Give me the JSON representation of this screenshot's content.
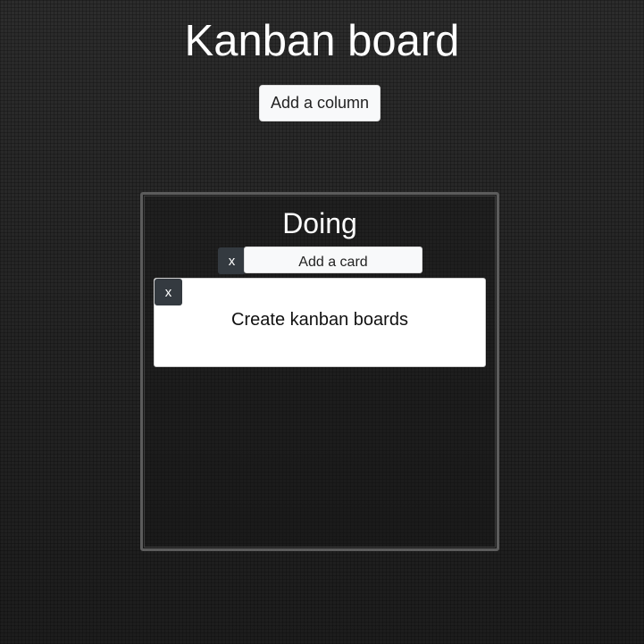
{
  "header": {
    "title": "Kanban board",
    "add_column_label": "Add a column"
  },
  "columns": [
    {
      "title": "Doing",
      "delete_label": "x",
      "add_card_label": "Add a card",
      "cards": [
        {
          "delete_label": "x",
          "text": "Create kanban boards"
        }
      ]
    }
  ],
  "colors": {
    "background": "#2a2a2a",
    "column_border": "#5c5c5c",
    "dark_button": "#343a40",
    "light_button": "#f8f9fa",
    "card_background": "#ffffff"
  }
}
